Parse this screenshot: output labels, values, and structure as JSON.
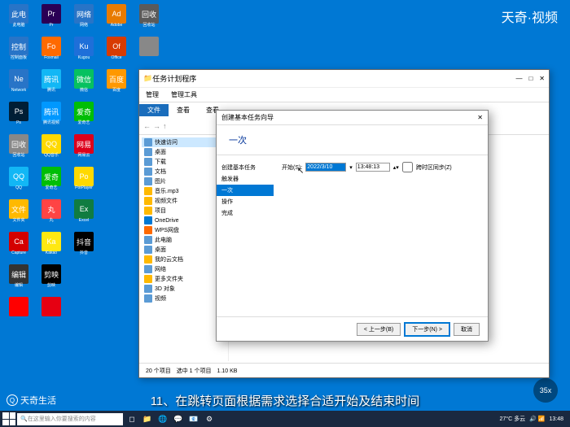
{
  "watermark": "天奇·视频",
  "caption": "11、在跳转页面根据需求选择合适开始及结束时间",
  "logo_bottom": "天奇生活",
  "badge": "35x",
  "desktop_icons": [
    {
      "lbl": "此电脑",
      "bg": "#2874c7"
    },
    {
      "lbl": "Pr",
      "bg": "#2a0055"
    },
    {
      "lbl": "网络",
      "bg": "#2874c7"
    },
    {
      "lbl": "Adobe",
      "bg": "#e87b00"
    },
    {
      "lbl": "回收站",
      "bg": "#5a5a5a"
    },
    {
      "lbl": "控制面板",
      "bg": "#2874c7"
    },
    {
      "lbl": "Foxmail",
      "bg": "#ff6a00"
    },
    {
      "lbl": "Kugou",
      "bg": "#1e6fd9"
    },
    {
      "lbl": "Office",
      "bg": "#d83b01"
    },
    {
      "lbl": "",
      "bg": "#888"
    },
    {
      "lbl": "Network",
      "bg": "#2874c7"
    },
    {
      "lbl": "腾讯",
      "bg": "#12b7f5"
    },
    {
      "lbl": "微信",
      "bg": "#07c160"
    },
    {
      "lbl": "百度",
      "bg": "#ff9800"
    },
    {
      "lbl": "",
      "bg": ""
    },
    {
      "lbl": "Ps",
      "bg": "#001e36"
    },
    {
      "lbl": "腾讯视频",
      "bg": "#0098ff"
    },
    {
      "lbl": "爱奇艺",
      "bg": "#00be06"
    },
    {
      "lbl": "",
      "bg": ""
    },
    {
      "lbl": "",
      "bg": ""
    },
    {
      "lbl": "回收站",
      "bg": "#888"
    },
    {
      "lbl": "QQ音乐",
      "bg": "#ffd900"
    },
    {
      "lbl": "网易云",
      "bg": "#dd001b"
    },
    {
      "lbl": "",
      "bg": ""
    },
    {
      "lbl": "",
      "bg": ""
    },
    {
      "lbl": "QQ",
      "bg": "#12b7f5"
    },
    {
      "lbl": "爱奇艺",
      "bg": "#00be06"
    },
    {
      "lbl": "PotPlayer",
      "bg": "#ffd900"
    },
    {
      "lbl": "",
      "bg": ""
    },
    {
      "lbl": "",
      "bg": ""
    },
    {
      "lbl": "文件夹",
      "bg": "#ffb900"
    },
    {
      "lbl": "丸",
      "bg": "#ff4444"
    },
    {
      "lbl": "Excel",
      "bg": "#107c41"
    },
    {
      "lbl": "",
      "bg": ""
    },
    {
      "lbl": "",
      "bg": ""
    },
    {
      "lbl": "Capture",
      "bg": "#d40000"
    },
    {
      "lbl": "Kakao",
      "bg": "#ffe812"
    },
    {
      "lbl": "抖音",
      "bg": "#000"
    },
    {
      "lbl": "",
      "bg": ""
    },
    {
      "lbl": "",
      "bg": ""
    },
    {
      "lbl": "编辑",
      "bg": "#333"
    },
    {
      "lbl": "剪映",
      "bg": "#000"
    },
    {
      "lbl": "",
      "bg": ""
    },
    {
      "lbl": "",
      "bg": ""
    },
    {
      "lbl": "",
      "bg": ""
    },
    {
      "lbl": "",
      "bg": "#ff0000"
    },
    {
      "lbl": "",
      "bg": "#e60012"
    },
    {
      "lbl": "",
      "bg": ""
    },
    {
      "lbl": "",
      "bg": ""
    },
    {
      "lbl": "",
      "bg": ""
    }
  ],
  "explorer": {
    "title": "任务计划程序",
    "ribbon": {
      "manage": "管理",
      "tools": "管理工具"
    },
    "tabs": {
      "file": "文件",
      "edit": "查看",
      "view": "查看"
    },
    "sidebar": [
      {
        "lbl": "快速访问",
        "ico": "#5b9bd5",
        "act": true
      },
      {
        "lbl": "桌面",
        "ico": "#5b9bd5"
      },
      {
        "lbl": "下载",
        "ico": "#5b9bd5"
      },
      {
        "lbl": "文档",
        "ico": "#5b9bd5"
      },
      {
        "lbl": "图片",
        "ico": "#5b9bd5"
      },
      {
        "lbl": "音乐.mp3",
        "ico": "#ffb900"
      },
      {
        "lbl": "视频文件",
        "ico": "#ffb900"
      },
      {
        "lbl": "项目",
        "ico": "#ffb900"
      },
      {
        "lbl": "OneDrive",
        "ico": "#0078d4"
      },
      {
        "lbl": "WPS网盘",
        "ico": "#ff6a00"
      },
      {
        "lbl": "此电脑",
        "ico": "#5b9bd5"
      },
      {
        "lbl": "桌面",
        "ico": "#5b9bd5"
      },
      {
        "lbl": "我的云文档",
        "ico": "#ffb900"
      },
      {
        "lbl": "网络",
        "ico": "#5b9bd5"
      },
      {
        "lbl": "更多文件夹",
        "ico": "#ffb900"
      },
      {
        "lbl": "3D 对象",
        "ico": "#5b9bd5"
      },
      {
        "lbl": "视频",
        "ico": "#5b9bd5"
      }
    ],
    "status": "20 个项目　选中 1 个项目　1.10 KB"
  },
  "wizard": {
    "title": "创建基本任务向导",
    "heading": "一次",
    "nav": [
      {
        "lbl": "创建基本任务"
      },
      {
        "lbl": "触发器"
      },
      {
        "lbl": "一次",
        "act": true
      },
      {
        "lbl": "操作"
      },
      {
        "lbl": "完成"
      }
    ],
    "form": {
      "start_label": "开始(S):",
      "date": "2022/3/10",
      "time": "13:48:13",
      "sync": "跨时区同步(Z)"
    },
    "buttons": {
      "back": "< 上一步(B)",
      "next": "下一步(N) >",
      "cancel": "取消"
    }
  },
  "taskbar": {
    "search": "在这里输入你要搜索的内容",
    "weather": "27°C 多云",
    "time": "13:48"
  }
}
